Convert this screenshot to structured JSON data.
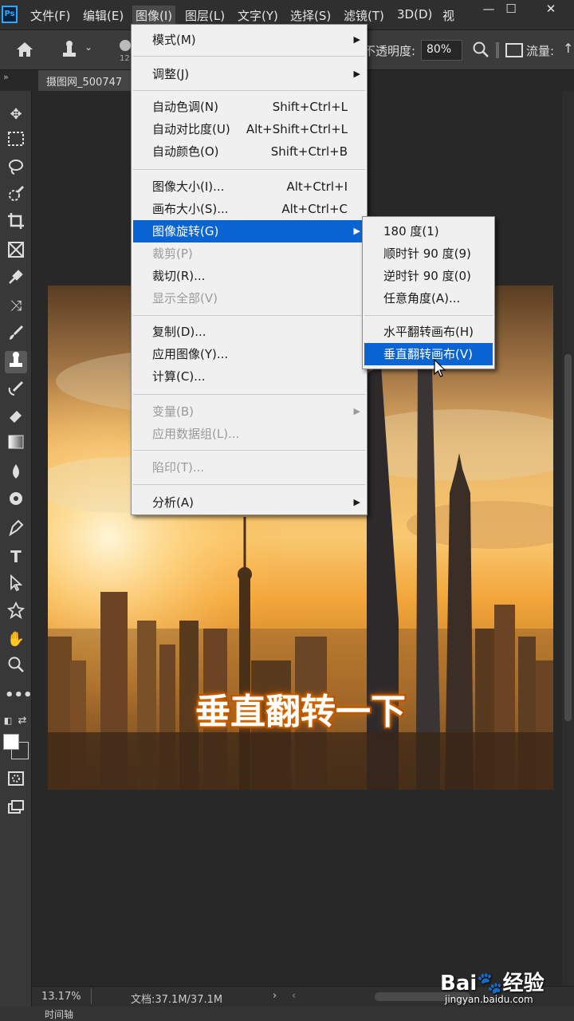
{
  "menubar": {
    "logo": "Ps",
    "items": [
      "文件(F)",
      "编辑(E)",
      "图像(I)",
      "图层(L)",
      "文字(Y)",
      "选择(S)",
      "滤镜(T)",
      "3D(D)",
      "视"
    ],
    "active_index": 2,
    "window_controls": [
      "—",
      "☐",
      "✕"
    ]
  },
  "options": {
    "brush_size": "12",
    "opacity_label": "不透明度:",
    "opacity_value": "80%",
    "flow_label": "流量:"
  },
  "tab": {
    "label": "摄图网_500747"
  },
  "image_menu": {
    "items": [
      {
        "label": "模式(M)",
        "shortcut": "",
        "submenu": true,
        "disabled": false
      },
      {
        "label": "调整(J)",
        "shortcut": "",
        "submenu": true,
        "disabled": false
      },
      {
        "label": "自动色调(N)",
        "shortcut": "Shift+Ctrl+L",
        "submenu": false,
        "disabled": false
      },
      {
        "label": "自动对比度(U)",
        "shortcut": "Alt+Shift+Ctrl+L",
        "submenu": false,
        "disabled": false
      },
      {
        "label": "自动颜色(O)",
        "shortcut": "Shift+Ctrl+B",
        "submenu": false,
        "disabled": false
      },
      {
        "label": "图像大小(I)...",
        "shortcut": "Alt+Ctrl+I",
        "submenu": false,
        "disabled": false
      },
      {
        "label": "画布大小(S)...",
        "shortcut": "Alt+Ctrl+C",
        "submenu": false,
        "disabled": false
      },
      {
        "label": "图像旋转(G)",
        "shortcut": "",
        "submenu": true,
        "disabled": false,
        "highlight": true
      },
      {
        "label": "裁剪(P)",
        "shortcut": "",
        "submenu": false,
        "disabled": true
      },
      {
        "label": "裁切(R)...",
        "shortcut": "",
        "submenu": false,
        "disabled": false
      },
      {
        "label": "显示全部(V)",
        "shortcut": "",
        "submenu": false,
        "disabled": true
      },
      {
        "label": "复制(D)...",
        "shortcut": "",
        "submenu": false,
        "disabled": false
      },
      {
        "label": "应用图像(Y)...",
        "shortcut": "",
        "submenu": false,
        "disabled": false
      },
      {
        "label": "计算(C)...",
        "shortcut": "",
        "submenu": false,
        "disabled": false
      },
      {
        "label": "变量(B)",
        "shortcut": "",
        "submenu": true,
        "disabled": true
      },
      {
        "label": "应用数据组(L)...",
        "shortcut": "",
        "submenu": false,
        "disabled": true
      },
      {
        "label": "陷印(T)...",
        "shortcut": "",
        "submenu": false,
        "disabled": true
      },
      {
        "label": "分析(A)",
        "shortcut": "",
        "submenu": true,
        "disabled": false
      }
    ]
  },
  "rotate_submenu": {
    "items": [
      {
        "label": "180 度(1)",
        "highlight": false
      },
      {
        "label": "顺时针 90 度(9)",
        "highlight": false
      },
      {
        "label": "逆时针 90 度(0)",
        "highlight": false
      },
      {
        "label": "任意角度(A)...",
        "highlight": false
      },
      {
        "label": "水平翻转画布(H)",
        "highlight": false
      },
      {
        "label": "垂直翻转画布(V)",
        "highlight": true
      }
    ]
  },
  "canvas": {
    "caption": "垂直翻转一下"
  },
  "status": {
    "zoom": "13.17%",
    "doc_info": "文档:37.1M/37.1M",
    "timeline": "时间轴"
  },
  "watermark": {
    "brand": "Bai🐾经验",
    "url": "jingyan.baidu.com"
  },
  "colors": {
    "menu_highlight": "#0a64d2",
    "panel_dark": "#282828",
    "toolbar": "#383838",
    "ps_blue": "#31a8ff"
  },
  "tools": [
    "move-icon",
    "marquee-icon",
    "lasso-icon",
    "quick-select-icon",
    "crop-icon",
    "frame-icon",
    "eyedropper-icon",
    "healing-icon",
    "brush-icon",
    "clone-stamp-icon",
    "history-brush-icon",
    "eraser-icon",
    "gradient-icon",
    "blur-icon",
    "dodge-icon",
    "pen-icon",
    "type-icon",
    "path-select-icon",
    "shape-icon",
    "hand-icon",
    "zoom-icon",
    "more-tools-icon"
  ]
}
